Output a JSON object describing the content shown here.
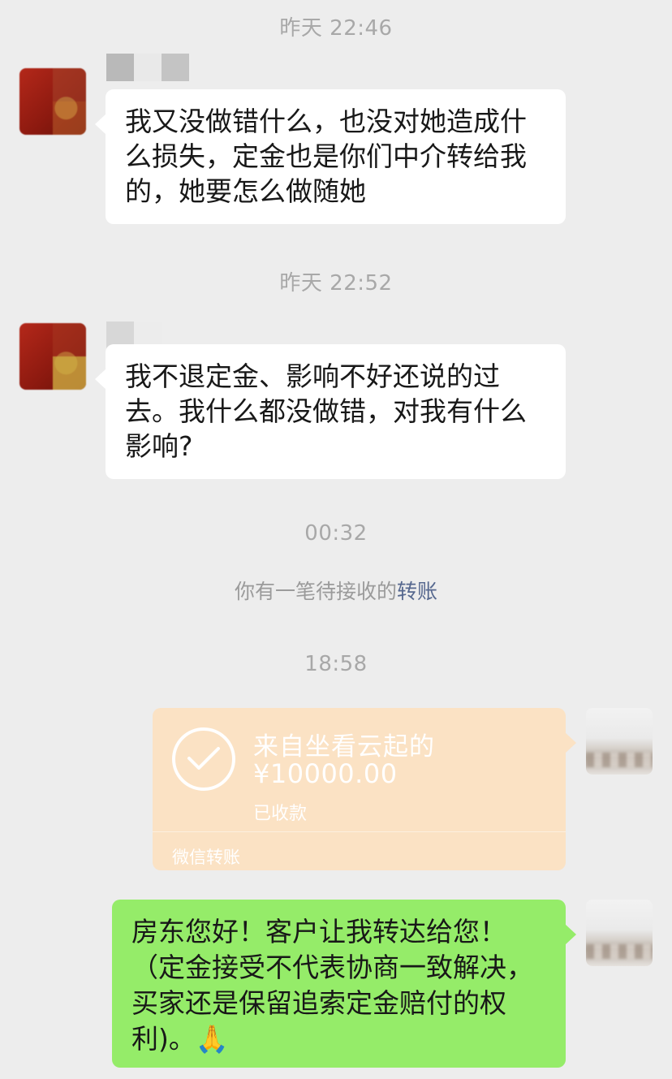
{
  "timestamps": [
    "昨天 22:46",
    "昨天 22:52",
    "00:32",
    "18:58"
  ],
  "system_notice": {
    "prefix": "你有一笔待接收的",
    "link": "转账"
  },
  "messages": [
    {
      "side": "left",
      "text": "我又没做错什么，也没对她造成什\n么损失，定金也是你们中介转给我\n的，她要怎么做随她"
    },
    {
      "side": "left",
      "text": "我不退定金、影响不好还说的过\n去。我什么都没做错，对我有什么\n影响?"
    },
    {
      "side": "right",
      "text": "房东您好！客户让我转达给您！\n（定金接受不代表协商一致解决，\n买家还是保留追索定金赔付的权\n利)。🙏"
    }
  ],
  "transfer": {
    "from": "来自坐看云起的",
    "amount": "¥10000.00",
    "status": "已收款",
    "footer": "微信转账",
    "icon": "check-circle-icon"
  },
  "colors": {
    "background": "#ededed",
    "bubble_white": "#ffffff",
    "bubble_green": "#95ec69",
    "transfer_card": "#fbe2c4",
    "link": "#56688f"
  }
}
